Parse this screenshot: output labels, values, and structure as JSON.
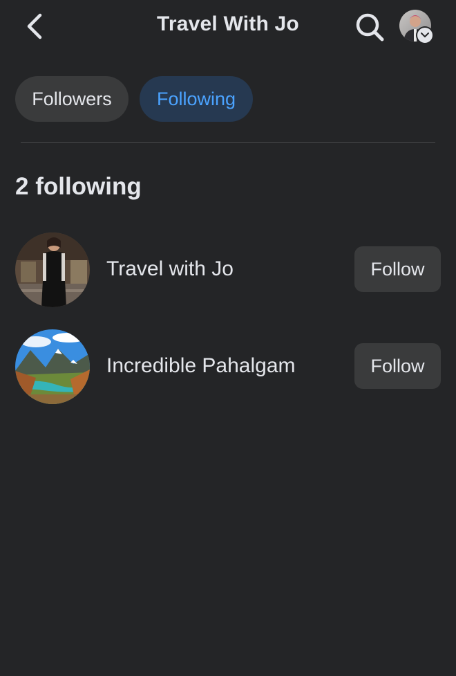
{
  "header": {
    "title": "Travel With Jo",
    "back_icon": "chevron-left-icon",
    "search_icon": "search-icon",
    "profile_badge_icon": "chevron-down-icon"
  },
  "tabs": [
    {
      "label": "Followers",
      "active": false
    },
    {
      "label": "Following",
      "active": true
    }
  ],
  "following": {
    "count_label": "2 following",
    "items": [
      {
        "name": "Travel with Jo",
        "button_label": "Follow"
      },
      {
        "name": "Incredible Pahalgam",
        "button_label": "Follow"
      }
    ]
  },
  "colors": {
    "background": "#242527",
    "chip": "#3a3b3c",
    "active_chip": "#263951",
    "accent": "#4ba3ff",
    "text": "#e4e6eb"
  }
}
